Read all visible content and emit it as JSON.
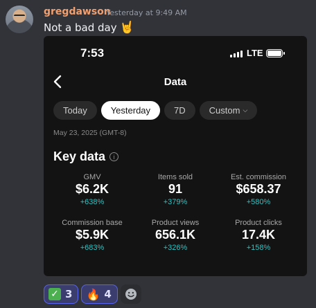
{
  "message": {
    "username": "gregdawson",
    "timestamp": "Yesterday at 9:49 AM",
    "text": "Not a bad day",
    "text_emoji": "🤘"
  },
  "screenshot": {
    "status_time": "7:53",
    "network": "LTE",
    "nav_title": "Data",
    "chips": [
      {
        "label": "Today",
        "active": false
      },
      {
        "label": "Yesterday",
        "active": true
      },
      {
        "label": "7D",
        "active": false
      },
      {
        "label": "Custom",
        "active": false
      }
    ],
    "date_range": "May 23, 2025 (GMT-8)",
    "section_title": "Key data",
    "metrics": [
      {
        "label": "GMV",
        "value": "$6.2K",
        "change": "+638%"
      },
      {
        "label": "Items sold",
        "value": "91",
        "change": "+379%"
      },
      {
        "label": "Est. commission",
        "value": "$658.37",
        "change": "+580%"
      },
      {
        "label": "Commission base",
        "value": "$5.9K",
        "change": "+683%"
      },
      {
        "label": "Product views",
        "value": "656.1K",
        "change": "+326%"
      },
      {
        "label": "Product clicks",
        "value": "17.4K",
        "change": "+158%"
      }
    ]
  },
  "reactions": [
    {
      "emoji": "check-mark-icon",
      "count": "3"
    },
    {
      "emoji": "🔥",
      "count": "4"
    }
  ],
  "colors": {
    "username": "#f0a070",
    "change_positive": "#2ec4c4",
    "reaction_border": "#5865f2"
  }
}
